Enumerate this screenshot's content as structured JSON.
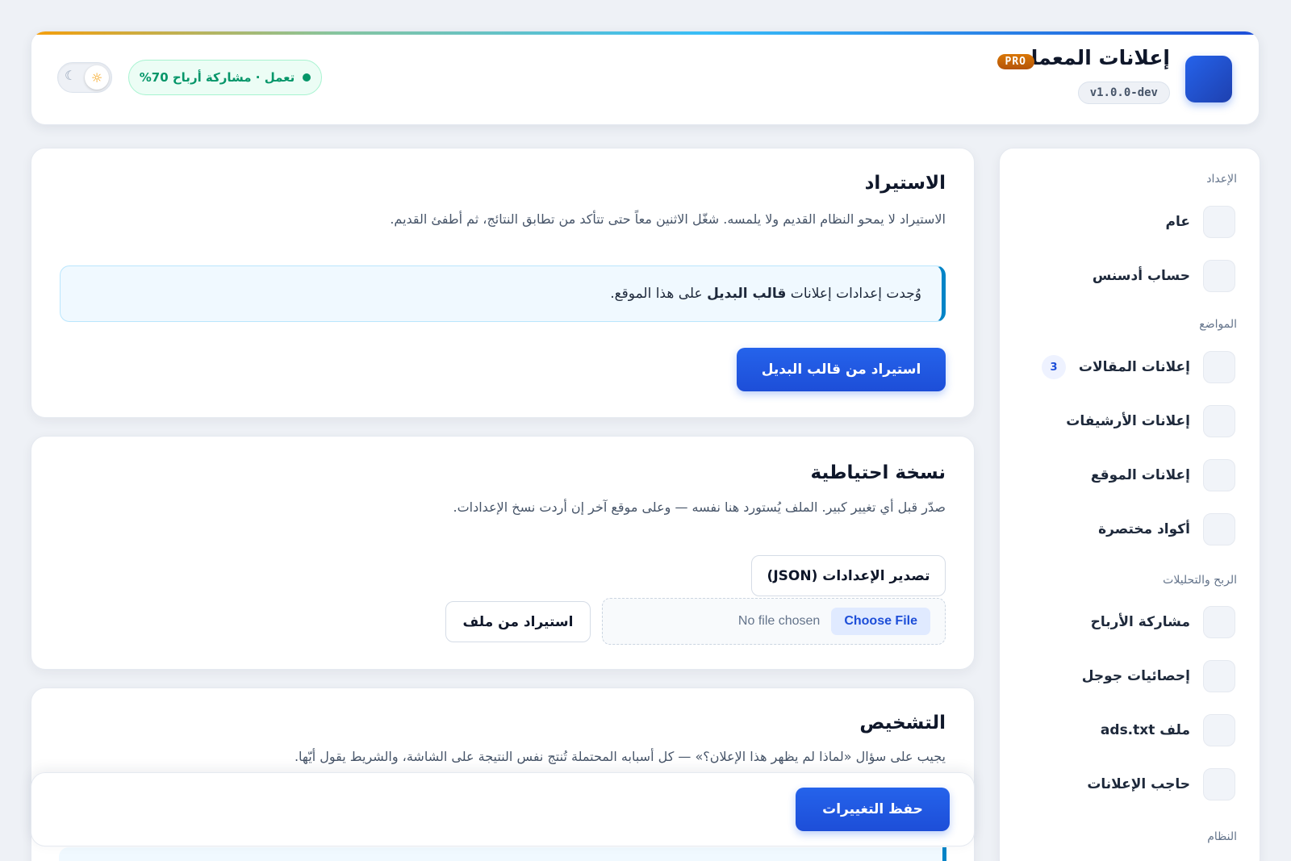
{
  "header": {
    "brand_title": "إعلانات المعمار",
    "pro_badge": "PRO",
    "version": "v1.0.0-dev",
    "status_text": "تعمل · مشاركة أرباح 70%",
    "theme_light_icon": "sun-icon",
    "theme_dark_icon": "moon-icon",
    "accent": "#2563eb"
  },
  "sidebar": {
    "sections": [
      {
        "title": "الإعداد",
        "items": [
          {
            "label": "عام"
          },
          {
            "label": "حساب أدسنس"
          }
        ]
      },
      {
        "title": "المواضع",
        "items": [
          {
            "label": "إعلانات المقالات",
            "count": "3"
          },
          {
            "label": "إعلانات الأرشيفات"
          },
          {
            "label": "إعلانات الموقع"
          },
          {
            "label": "أكواد مختصرة"
          }
        ]
      },
      {
        "title": "الربح والتحليلات",
        "items": [
          {
            "label": "مشاركة الأرباح"
          },
          {
            "label": "إحصائيات جوجل"
          },
          {
            "label": "ملف ads.txt"
          },
          {
            "label": "حاجب الإعلانات"
          }
        ]
      },
      {
        "title": "النظام",
        "items": []
      }
    ]
  },
  "import_card": {
    "title": "الاستيراد",
    "description": "الاستيراد لا يمحو النظام القديم ولا يلمسه. شغّل الاثنين معاً حتى تتأكد من تطابق النتائج، ثم أطفئ القديم.",
    "notice_prefix": "وُجدت إعدادات إعلانات ",
    "notice_bold": "قالب البديل",
    "notice_suffix": " على هذا الموقع.",
    "import_button": "استيراد من قالب البديل"
  },
  "backup_card": {
    "title": "نسخة احتياطية",
    "description": "صدّر قبل أي تغيير كبير. الملف يُستورد هنا نفسه — وعلى موقع آخر إن أردت نسخ الإعدادات.",
    "export_button": "تصدير الإعدادات (JSON)",
    "choose_file": "Choose File",
    "no_file": "No file chosen",
    "import_file_button": "استيراد من ملف"
  },
  "diagnostics_card": {
    "title": "التشخيص",
    "description": "يجيب على سؤال «لماذا لم يظهر هذا الإعلان؟» — كل أسبابه المحتملة تُنتج نفس النتيجة على الشاشة، والشريط يقول أيّها."
  },
  "savebar": {
    "save_button": "حفظ التغييرات"
  }
}
